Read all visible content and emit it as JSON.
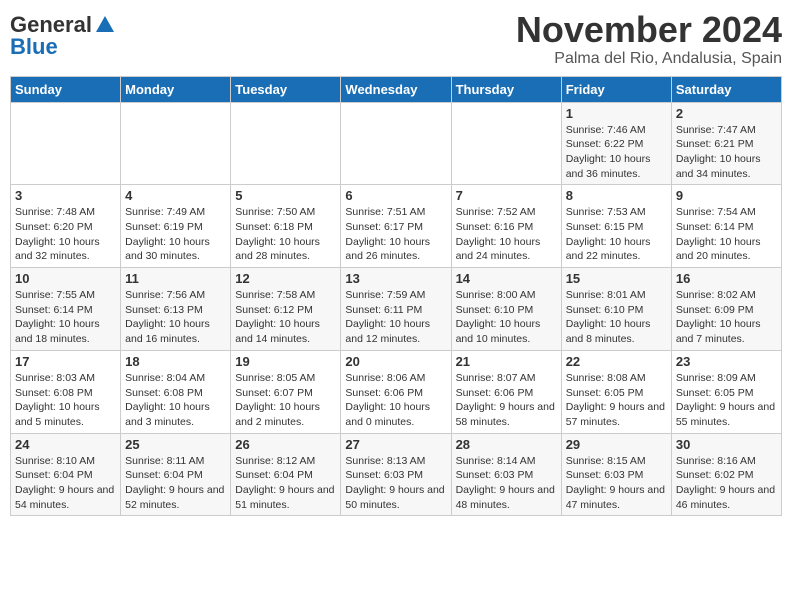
{
  "logo": {
    "general": "General",
    "blue": "Blue"
  },
  "title": "November 2024",
  "location": "Palma del Rio, Andalusia, Spain",
  "weekdays": [
    "Sunday",
    "Monday",
    "Tuesday",
    "Wednesday",
    "Thursday",
    "Friday",
    "Saturday"
  ],
  "weeks": [
    [
      {
        "day": "",
        "info": ""
      },
      {
        "day": "",
        "info": ""
      },
      {
        "day": "",
        "info": ""
      },
      {
        "day": "",
        "info": ""
      },
      {
        "day": "",
        "info": ""
      },
      {
        "day": "1",
        "info": "Sunrise: 7:46 AM\nSunset: 6:22 PM\nDaylight: 10 hours and 36 minutes."
      },
      {
        "day": "2",
        "info": "Sunrise: 7:47 AM\nSunset: 6:21 PM\nDaylight: 10 hours and 34 minutes."
      }
    ],
    [
      {
        "day": "3",
        "info": "Sunrise: 7:48 AM\nSunset: 6:20 PM\nDaylight: 10 hours and 32 minutes."
      },
      {
        "day": "4",
        "info": "Sunrise: 7:49 AM\nSunset: 6:19 PM\nDaylight: 10 hours and 30 minutes."
      },
      {
        "day": "5",
        "info": "Sunrise: 7:50 AM\nSunset: 6:18 PM\nDaylight: 10 hours and 28 minutes."
      },
      {
        "day": "6",
        "info": "Sunrise: 7:51 AM\nSunset: 6:17 PM\nDaylight: 10 hours and 26 minutes."
      },
      {
        "day": "7",
        "info": "Sunrise: 7:52 AM\nSunset: 6:16 PM\nDaylight: 10 hours and 24 minutes."
      },
      {
        "day": "8",
        "info": "Sunrise: 7:53 AM\nSunset: 6:15 PM\nDaylight: 10 hours and 22 minutes."
      },
      {
        "day": "9",
        "info": "Sunrise: 7:54 AM\nSunset: 6:14 PM\nDaylight: 10 hours and 20 minutes."
      }
    ],
    [
      {
        "day": "10",
        "info": "Sunrise: 7:55 AM\nSunset: 6:14 PM\nDaylight: 10 hours and 18 minutes."
      },
      {
        "day": "11",
        "info": "Sunrise: 7:56 AM\nSunset: 6:13 PM\nDaylight: 10 hours and 16 minutes."
      },
      {
        "day": "12",
        "info": "Sunrise: 7:58 AM\nSunset: 6:12 PM\nDaylight: 10 hours and 14 minutes."
      },
      {
        "day": "13",
        "info": "Sunrise: 7:59 AM\nSunset: 6:11 PM\nDaylight: 10 hours and 12 minutes."
      },
      {
        "day": "14",
        "info": "Sunrise: 8:00 AM\nSunset: 6:10 PM\nDaylight: 10 hours and 10 minutes."
      },
      {
        "day": "15",
        "info": "Sunrise: 8:01 AM\nSunset: 6:10 PM\nDaylight: 10 hours and 8 minutes."
      },
      {
        "day": "16",
        "info": "Sunrise: 8:02 AM\nSunset: 6:09 PM\nDaylight: 10 hours and 7 minutes."
      }
    ],
    [
      {
        "day": "17",
        "info": "Sunrise: 8:03 AM\nSunset: 6:08 PM\nDaylight: 10 hours and 5 minutes."
      },
      {
        "day": "18",
        "info": "Sunrise: 8:04 AM\nSunset: 6:08 PM\nDaylight: 10 hours and 3 minutes."
      },
      {
        "day": "19",
        "info": "Sunrise: 8:05 AM\nSunset: 6:07 PM\nDaylight: 10 hours and 2 minutes."
      },
      {
        "day": "20",
        "info": "Sunrise: 8:06 AM\nSunset: 6:06 PM\nDaylight: 10 hours and 0 minutes."
      },
      {
        "day": "21",
        "info": "Sunrise: 8:07 AM\nSunset: 6:06 PM\nDaylight: 9 hours and 58 minutes."
      },
      {
        "day": "22",
        "info": "Sunrise: 8:08 AM\nSunset: 6:05 PM\nDaylight: 9 hours and 57 minutes."
      },
      {
        "day": "23",
        "info": "Sunrise: 8:09 AM\nSunset: 6:05 PM\nDaylight: 9 hours and 55 minutes."
      }
    ],
    [
      {
        "day": "24",
        "info": "Sunrise: 8:10 AM\nSunset: 6:04 PM\nDaylight: 9 hours and 54 minutes."
      },
      {
        "day": "25",
        "info": "Sunrise: 8:11 AM\nSunset: 6:04 PM\nDaylight: 9 hours and 52 minutes."
      },
      {
        "day": "26",
        "info": "Sunrise: 8:12 AM\nSunset: 6:04 PM\nDaylight: 9 hours and 51 minutes."
      },
      {
        "day": "27",
        "info": "Sunrise: 8:13 AM\nSunset: 6:03 PM\nDaylight: 9 hours and 50 minutes."
      },
      {
        "day": "28",
        "info": "Sunrise: 8:14 AM\nSunset: 6:03 PM\nDaylight: 9 hours and 48 minutes."
      },
      {
        "day": "29",
        "info": "Sunrise: 8:15 AM\nSunset: 6:03 PM\nDaylight: 9 hours and 47 minutes."
      },
      {
        "day": "30",
        "info": "Sunrise: 8:16 AM\nSunset: 6:02 PM\nDaylight: 9 hours and 46 minutes."
      }
    ]
  ]
}
